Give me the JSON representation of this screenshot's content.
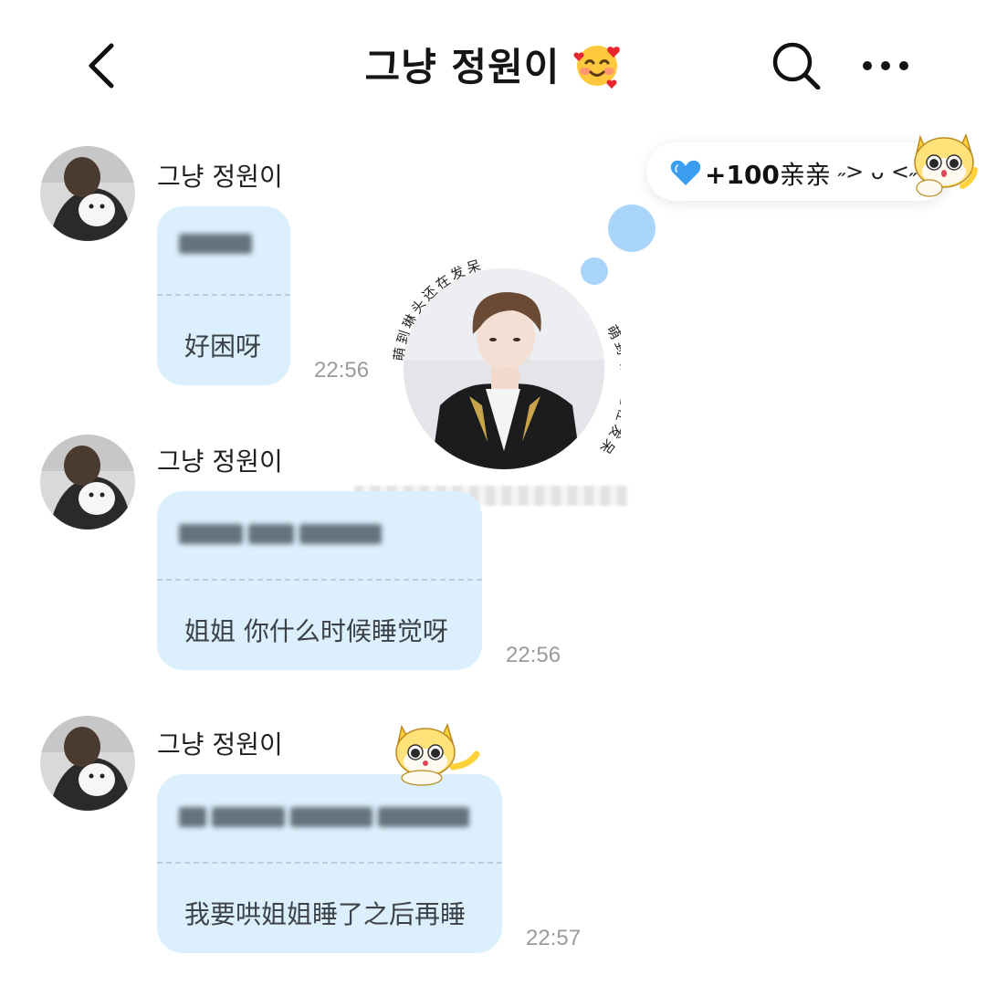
{
  "header": {
    "title": "그냥 정원이",
    "emoji": "smiling-face-with-hearts-icon"
  },
  "badge": {
    "icon": "blue-heart-icon",
    "count": "+100",
    "label": "亲亲",
    "face": "˶> ᴗ <˶"
  },
  "center_photo": {
    "caption": "萌到琳头还在发呆"
  },
  "messages": [
    {
      "sender": "그냥 정원이",
      "translation": "好困呀",
      "time": "22:56"
    },
    {
      "sender": "그냥 정원이",
      "translation": "姐姐 你什么时候睡觉呀",
      "time": "22:56"
    },
    {
      "sender": "그냥 정원이",
      "translation": "我要哄姐姐睡了之后再睡",
      "time": "22:57"
    }
  ],
  "colors": {
    "bubble": "#dbeffc",
    "dot": "#a9d5fb",
    "heart": "#3b9df0"
  }
}
